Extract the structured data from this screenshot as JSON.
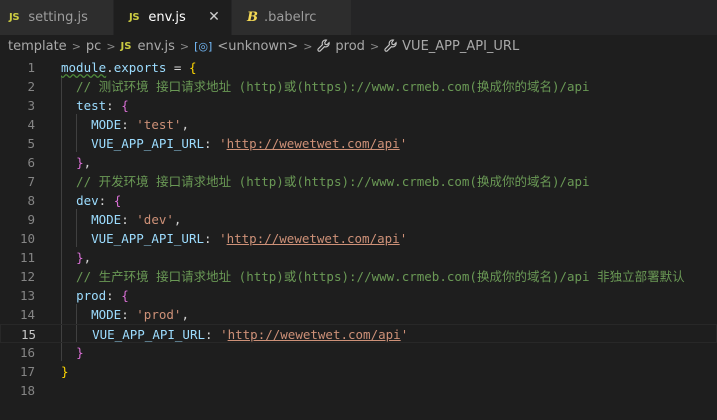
{
  "tabs": [
    {
      "icon": "JS",
      "label": "setting.js"
    },
    {
      "icon": "JS",
      "label": "env.js",
      "close": "✕"
    },
    {
      "icon": "B",
      "label": ".babelrc"
    }
  ],
  "breadcrumb": {
    "folder1": "template",
    "folder2": "pc",
    "file_icon": "JS",
    "file": "env.js",
    "symbol_icon": "[◎]",
    "symbol": "<unknown>",
    "prop1": "prod",
    "prop2": "VUE_APP_API_URL"
  },
  "editor": {
    "active_line": 15,
    "lines": [
      {
        "num": "1",
        "tokens": [
          {
            "t": "module",
            "c": "var squiggle"
          },
          {
            "t": ".",
            "c": "pl"
          },
          {
            "t": "exports",
            "c": "var"
          },
          {
            "t": " = ",
            "c": "pl"
          },
          {
            "t": "{",
            "c": "b1"
          }
        ]
      },
      {
        "num": "2",
        "tokens": [
          {
            "t": "  // 测试环境 接口请求地址 (http)或(https)://www.crmeb.com(换成你的域名)/api",
            "c": "cm"
          }
        ]
      },
      {
        "num": "3",
        "tokens": [
          {
            "t": "  ",
            "c": "pl"
          },
          {
            "t": "test",
            "c": "prop"
          },
          {
            "t": ": ",
            "c": "pl"
          },
          {
            "t": "{",
            "c": "b2"
          }
        ]
      },
      {
        "num": "4",
        "tokens": [
          {
            "t": "    ",
            "c": "pl"
          },
          {
            "t": "MODE",
            "c": "prop"
          },
          {
            "t": ": ",
            "c": "pl"
          },
          {
            "t": "'test'",
            "c": "str"
          },
          {
            "t": ",",
            "c": "pl"
          }
        ]
      },
      {
        "num": "5",
        "tokens": [
          {
            "t": "    ",
            "c": "pl"
          },
          {
            "t": "VUE_APP_API_URL",
            "c": "prop"
          },
          {
            "t": ": ",
            "c": "pl"
          },
          {
            "t": "'",
            "c": "str"
          },
          {
            "t": "http://wewetwet.com/api",
            "c": "url"
          },
          {
            "t": "'",
            "c": "str"
          }
        ]
      },
      {
        "num": "6",
        "tokens": [
          {
            "t": "  ",
            "c": "pl"
          },
          {
            "t": "}",
            "c": "b2"
          },
          {
            "t": ",",
            "c": "pl"
          }
        ]
      },
      {
        "num": "7",
        "tokens": [
          {
            "t": "  // 开发环境 接口请求地址 (http)或(https)://www.crmeb.com(换成你的域名)/api",
            "c": "cm"
          }
        ]
      },
      {
        "num": "8",
        "tokens": [
          {
            "t": "  ",
            "c": "pl"
          },
          {
            "t": "dev",
            "c": "prop"
          },
          {
            "t": ": ",
            "c": "pl"
          },
          {
            "t": "{",
            "c": "b2"
          }
        ]
      },
      {
        "num": "9",
        "tokens": [
          {
            "t": "    ",
            "c": "pl"
          },
          {
            "t": "MODE",
            "c": "prop"
          },
          {
            "t": ": ",
            "c": "pl"
          },
          {
            "t": "'dev'",
            "c": "str"
          },
          {
            "t": ",",
            "c": "pl"
          }
        ]
      },
      {
        "num": "10",
        "tokens": [
          {
            "t": "    ",
            "c": "pl"
          },
          {
            "t": "VUE_APP_API_URL",
            "c": "prop"
          },
          {
            "t": ": ",
            "c": "pl"
          },
          {
            "t": "'",
            "c": "str"
          },
          {
            "t": "http://wewetwet.com/api",
            "c": "url"
          },
          {
            "t": "'",
            "c": "str"
          }
        ]
      },
      {
        "num": "11",
        "tokens": [
          {
            "t": "  ",
            "c": "pl"
          },
          {
            "t": "}",
            "c": "b2"
          },
          {
            "t": ",",
            "c": "pl"
          }
        ]
      },
      {
        "num": "12",
        "tokens": [
          {
            "t": "  // 生产环境 接口请求地址 (http)或(https)://www.crmeb.com(换成你的域名)/api 非独立部署默认",
            "c": "cm"
          }
        ]
      },
      {
        "num": "13",
        "tokens": [
          {
            "t": "  ",
            "c": "pl"
          },
          {
            "t": "prod",
            "c": "prop"
          },
          {
            "t": ": ",
            "c": "pl"
          },
          {
            "t": "{",
            "c": "b2"
          }
        ]
      },
      {
        "num": "14",
        "tokens": [
          {
            "t": "    ",
            "c": "pl"
          },
          {
            "t": "MODE",
            "c": "prop"
          },
          {
            "t": ": ",
            "c": "pl"
          },
          {
            "t": "'prod'",
            "c": "str"
          },
          {
            "t": ",",
            "c": "pl"
          }
        ]
      },
      {
        "num": "15",
        "tokens": [
          {
            "t": "    ",
            "c": "pl"
          },
          {
            "t": "VUE_APP_API_URL",
            "c": "prop"
          },
          {
            "t": ": ",
            "c": "pl"
          },
          {
            "t": "'",
            "c": "str"
          },
          {
            "t": "http://wewetwet.com/api",
            "c": "url"
          },
          {
            "t": "'",
            "c": "str"
          }
        ]
      },
      {
        "num": "16",
        "tokens": [
          {
            "t": "  ",
            "c": "pl"
          },
          {
            "t": "}",
            "c": "b2"
          }
        ]
      },
      {
        "num": "17",
        "tokens": [
          {
            "t": "}",
            "c": "b1"
          }
        ]
      },
      {
        "num": "18",
        "tokens": []
      }
    ]
  },
  "colors": {
    "background": "#1e1e1e",
    "comment": "#6a9955",
    "string": "#ce9178",
    "property": "#9cdcfe",
    "bracket_level1": "#ffd700",
    "bracket_level2": "#da70d6"
  }
}
